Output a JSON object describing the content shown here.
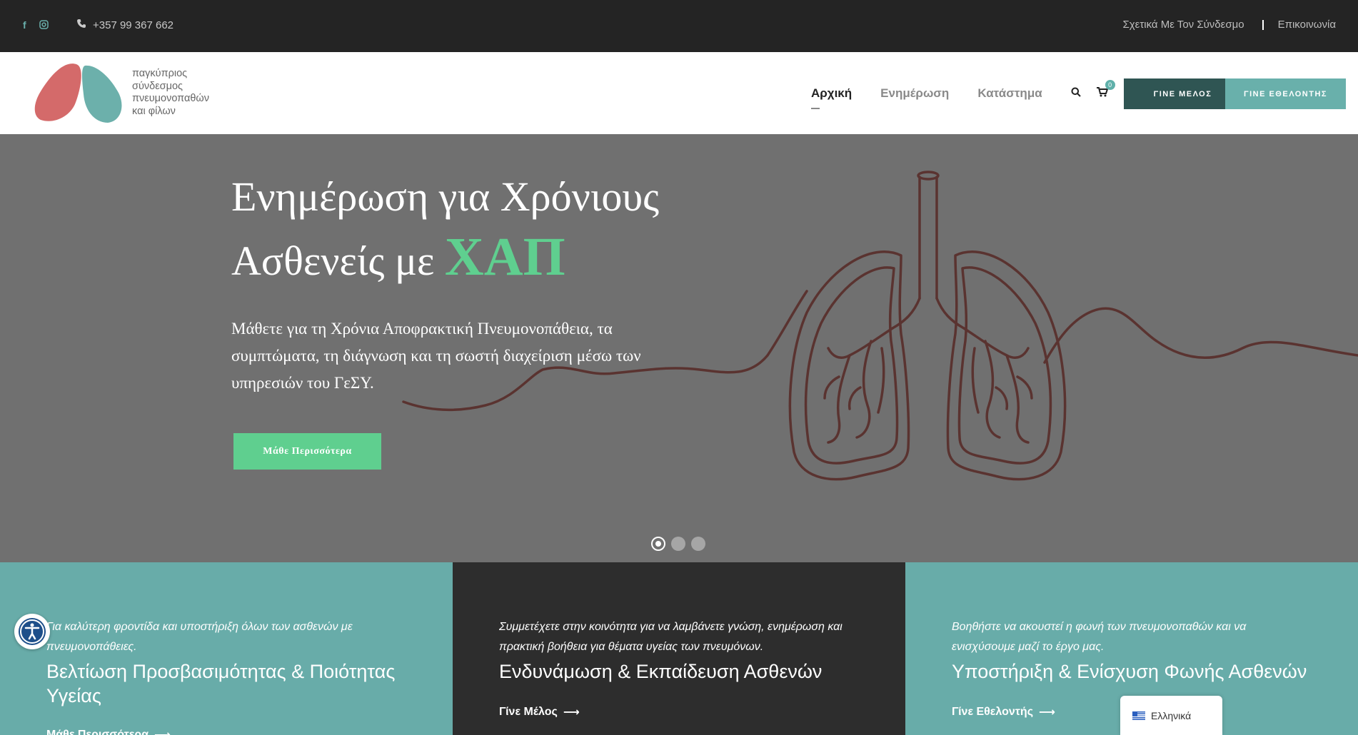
{
  "topbar": {
    "phone": "+357 99 367 662",
    "links": [
      "Σχετικά Με Τον Σύνδεσμο",
      "Επικοινωνία"
    ],
    "social_icons": [
      "facebook-icon",
      "instagram-icon"
    ]
  },
  "header": {
    "logo_lines": [
      "παγκύπριος",
      "σύνδεσμος",
      "πνευμονοπαθών",
      "και φίλων"
    ],
    "nav": [
      "Αρχική",
      "Ενημέρωση",
      "Κατάστημα"
    ],
    "cart_count": "0",
    "buttons": [
      "ΓΙΝΕ ΜΕΛΟΣ",
      "ΓΙΝΕ ΕΘΕΛΟΝΤΗΣ"
    ]
  },
  "hero": {
    "title_line1": "Ενημέρωση για Χρόνιους",
    "title_line2": "Ασθενείς με",
    "title_accent": "ΧΑΠ",
    "description": "Μάθετε για τη Χρόνια Αποφρακτική Πνευμονοπάθεια, τα συμπτώματα, τη διάγνωση και τη σωστή διαχείριση μέσω των υπηρεσιών του ΓεΣΥ.",
    "button": "Μάθε Περισσότερα",
    "slides": 3,
    "active_slide": 1
  },
  "features": [
    {
      "intro": "Για καλύτερη φροντίδα και υποστήριξη όλων των ασθενών με πνευμονοπάθειες.",
      "title": "Βελτίωση Προσβασιμότητας & Ποιότητας Υγείας",
      "cta": "Μάθε Περισσότερα"
    },
    {
      "intro": "Συμμετέχετε στην κοινότητα για να λαμβάνετε γνώση, ενημέρωση και πρακτική βοήθεια για θέματα υγείας των πνευμόνων.",
      "title": "Ενδυνάμωση & Εκπαίδευση Ασθενών",
      "cta": "Γίνε Μέλος"
    },
    {
      "intro": "Βοηθήστε να ακουστεί η φωνή των πνευμονοπαθών και να ενισχύσουμε μαζί το έργο μας.",
      "title": "Υποστήριξη & Ενίσχυση Φωνής Ασθενών",
      "cta": "Γίνε Εθελοντής"
    }
  ],
  "language": "Ελληνικά",
  "colors": {
    "topbar": "#242424",
    "teal": "#68aca9",
    "dark_teal": "#2f5553",
    "green_accent": "#5fcf8f",
    "hero_bg": "#707070",
    "lung_line": "#5a3330"
  }
}
